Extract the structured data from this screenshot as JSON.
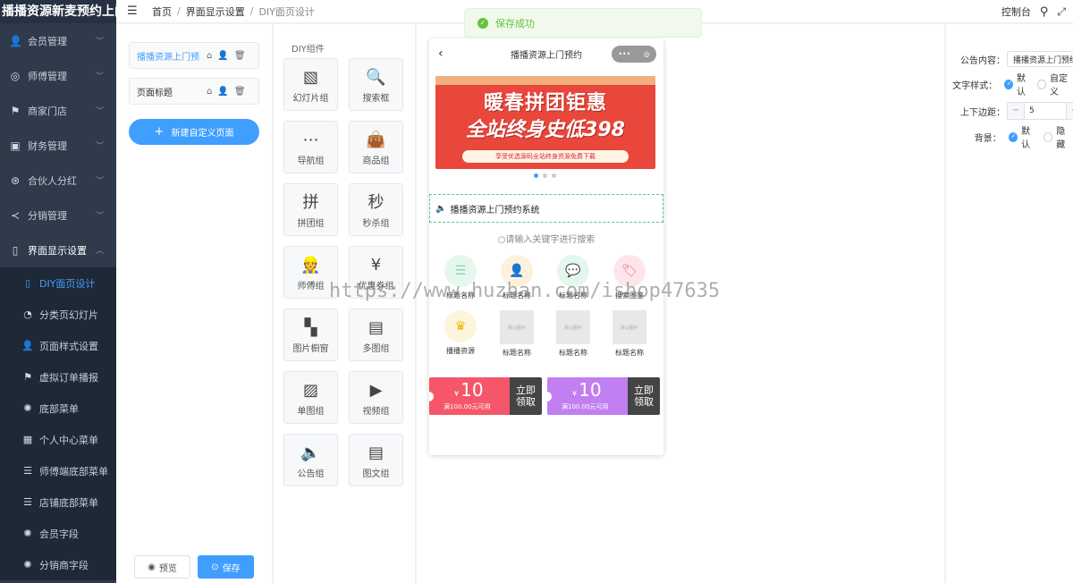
{
  "brand": "播播资源新麦预约上门",
  "menu": [
    {
      "label": "会员管理",
      "icon": "👤",
      "icon_name": "user-icon"
    },
    {
      "label": "师傅管理",
      "icon": "◎",
      "icon_name": "target-icon"
    },
    {
      "label": "商家门店",
      "icon": "⚑",
      "icon_name": "flag-icon"
    },
    {
      "label": "财务管理",
      "icon": "▣",
      "icon_name": "wallet-icon"
    },
    {
      "label": "合伙人分红",
      "icon": "⊛",
      "icon_name": "globe-icon"
    },
    {
      "label": "分销管理",
      "icon": "≺",
      "icon_name": "share-icon"
    },
    {
      "label": "界面显示设置",
      "icon": "▯",
      "icon_name": "phone-icon"
    }
  ],
  "submenu": [
    {
      "label": "DIY面页设计",
      "icon": "▯",
      "icon_name": "phone-icon"
    },
    {
      "label": "分类页幻灯片",
      "icon": "◔",
      "icon_name": "dashboard-icon"
    },
    {
      "label": "页面样式设置",
      "icon": "👤",
      "icon_name": "user-icon"
    },
    {
      "label": "虚拟订单播报",
      "icon": "⚑",
      "icon_name": "flag-icon"
    },
    {
      "label": "底部菜单",
      "icon": "✺",
      "icon_name": "gear-icon"
    },
    {
      "label": "个人中心菜单",
      "icon": "▦",
      "icon_name": "grid-icon"
    },
    {
      "label": "师傅端底部菜单",
      "icon": "☰",
      "icon_name": "sliders-icon"
    },
    {
      "label": "店铺底部菜单",
      "icon": "☰",
      "icon_name": "sliders-icon"
    },
    {
      "label": "会员字段",
      "icon": "✺",
      "icon_name": "gear-icon"
    },
    {
      "label": "分销商字段",
      "icon": "✺",
      "icon_name": "gear-icon"
    }
  ],
  "breadcrumb": [
    "首页",
    "界面显示设置",
    "DIY面页设计"
  ],
  "topbar": {
    "console": "控制台"
  },
  "toast": {
    "message": "保存成功"
  },
  "pages": [
    {
      "name": "播播资源上门预"
    },
    {
      "name": "页面标题"
    }
  ],
  "new_page_label": "新建自定义页面",
  "preview_label": "预览",
  "save_label": "保存",
  "components_title": "DIY组件",
  "components": [
    {
      "label": "幻灯片组",
      "icon": "▧",
      "icon_name": "slides-icon"
    },
    {
      "label": "搜索框",
      "icon": "🔍",
      "icon_name": "search-icon"
    },
    {
      "label": "导航组",
      "icon": "⋯",
      "icon_name": "dots-grid-icon"
    },
    {
      "label": "商品组",
      "icon": "👜",
      "icon_name": "bag-icon"
    },
    {
      "label": "拼团组",
      "icon": "拼",
      "icon_name": "group-buy-icon"
    },
    {
      "label": "秒杀组",
      "icon": "秒",
      "icon_name": "flash-sale-icon"
    },
    {
      "label": "师傅组",
      "icon": "👷",
      "icon_name": "worker-icon"
    },
    {
      "label": "优惠券组",
      "icon": "¥",
      "icon_name": "coupon-icon"
    },
    {
      "label": "图片橱窗",
      "icon": "▚",
      "icon_name": "window-icon"
    },
    {
      "label": "多图组",
      "icon": "▤",
      "icon_name": "multi-image-icon"
    },
    {
      "label": "单图组",
      "icon": "▨",
      "icon_name": "image-icon"
    },
    {
      "label": "视频组",
      "icon": "▶",
      "icon_name": "video-icon"
    },
    {
      "label": "公告组",
      "icon": "🔈",
      "icon_name": "speaker-icon"
    },
    {
      "label": "图文组",
      "icon": "▤",
      "icon_name": "article-icon"
    }
  ],
  "phone": {
    "title": "播播资源上门预约",
    "banner_line1": "暖春拼团钜惠",
    "banner_line2": "全站终身史低398",
    "banner_sub": "享受优选源码全站终身资源免费下载",
    "notice": "播播资源上门预约系统",
    "search_placeholder": "请输入关键字进行搜索",
    "nav": [
      {
        "label": "标题名称",
        "color": "#7fd6a8",
        "bg": "#e6f7ee"
      },
      {
        "label": "标题名称",
        "color": "#f5a623",
        "bg": "#fdf1dd"
      },
      {
        "label": "标题名称",
        "color": "#3ccf8e",
        "bg": "#e3f7ed"
      },
      {
        "label": "搜索图鉴",
        "color": "#f36b8d",
        "bg": "#fde5ea"
      },
      {
        "label": "播播资源",
        "color": "#f5b400",
        "bg": "#fdf4dc"
      },
      {
        "label": "标题名称",
        "placeholder": "默认图片"
      },
      {
        "label": "标题名称",
        "placeholder": "默认图片"
      },
      {
        "label": "标题名称",
        "placeholder": "默认图片"
      }
    ],
    "coupons": [
      {
        "currency": "¥",
        "amount": "10",
        "condition": "满100.00元可用",
        "action_line1": "立即",
        "action_line2": "领取",
        "color": "#f5566a"
      },
      {
        "currency": "¥",
        "amount": "10",
        "condition": "满100.00元可用",
        "action_line1": "立即",
        "action_line2": "领取",
        "color": "#c27ff2"
      }
    ]
  },
  "props": {
    "notice_label": "公告内容：",
    "notice_value": "播播资源上门预约系统",
    "text_style_label": "文字样式：",
    "text_style_options": [
      "默认",
      "自定义"
    ],
    "padding_label": "上下边距：",
    "padding_value": "5",
    "bg_label": "背景：",
    "bg_options": [
      "默认",
      "隐藏"
    ]
  },
  "watermark": "https://www.huzhan.com/ishop47635"
}
